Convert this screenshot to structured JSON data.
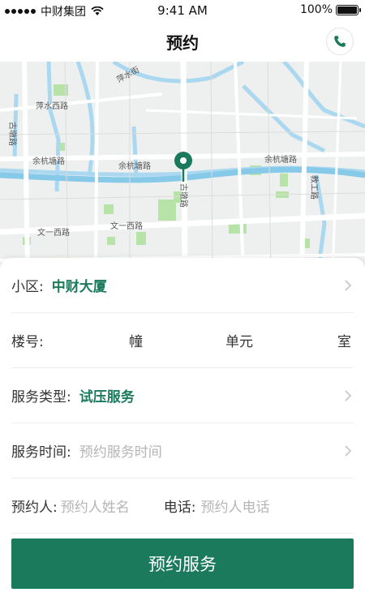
{
  "status_bar": {
    "carrier": "中财集团",
    "time": "9:41 AM",
    "battery": "100%"
  },
  "nav": {
    "title": "预约",
    "phone_icon": "phone-icon"
  },
  "map": {
    "labels": {
      "pingshui_street": "萍水街",
      "pingshui_west_road": "萍水西路",
      "gudun_road_left": "古墩路",
      "yuhangtang_road_left": "余杭塘路",
      "yuhangtang_road_mid": "余杭塘路",
      "yuhangtang_road_right": "余杭塘路",
      "gudun_road_mid": "古墩路",
      "jiaogong_road": "教工路",
      "wenyi_west_road_left": "文一西路",
      "wenyi_west_road_mid": "文一西路"
    },
    "marker_icon": "map-pin-icon",
    "locate_icon": "locate-icon"
  },
  "form": {
    "community": {
      "label": "小区:",
      "value": "中财大厦"
    },
    "building": {
      "label": "楼号:",
      "unit_building": "幢",
      "unit_unit": "单元",
      "unit_room": "室"
    },
    "service_type": {
      "label": "服务类型:",
      "value": "试压服务"
    },
    "service_time": {
      "label": "服务时间:",
      "placeholder": "预约服务时间"
    },
    "booker": {
      "label": "预约人:",
      "placeholder": "预约人姓名"
    },
    "phone": {
      "label": "电话:",
      "placeholder": "预约人电话"
    }
  },
  "submit_label": "预约服务",
  "colors": {
    "accent": "#1b7a5c",
    "placeholder": "#b5b5b5",
    "water": "#a9d8f0",
    "park": "#b8e3a8"
  }
}
